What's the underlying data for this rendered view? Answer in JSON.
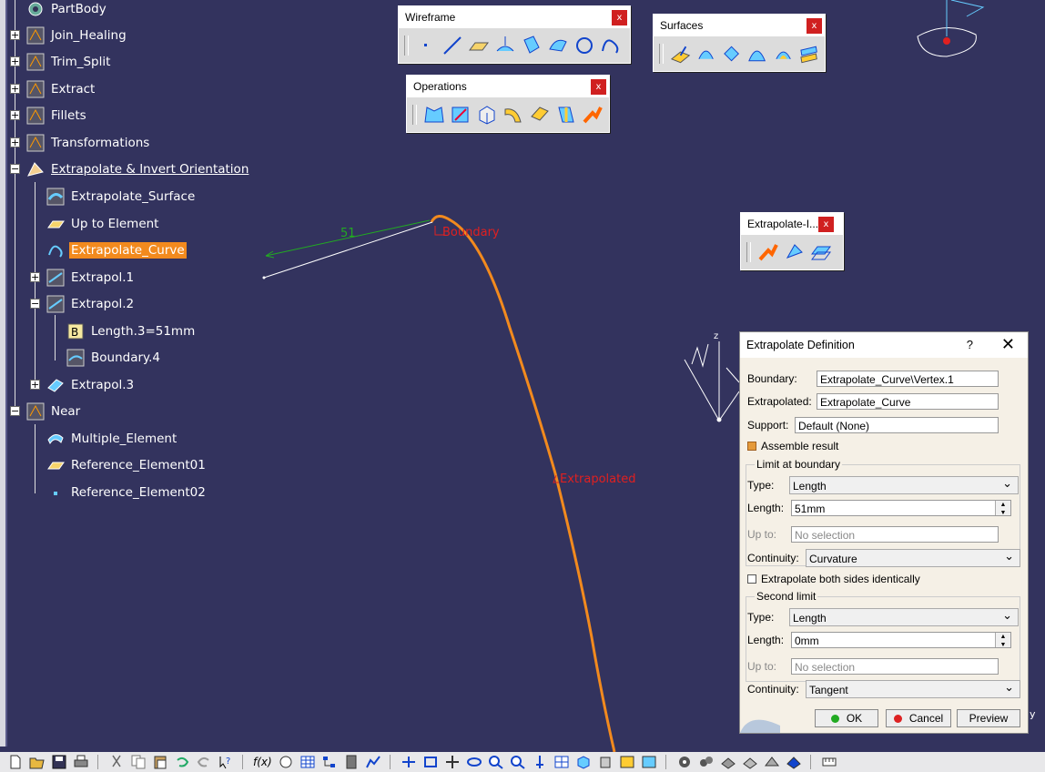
{
  "tree": {
    "items": [
      {
        "label": "PartBody"
      },
      {
        "label": "Join_Healing"
      },
      {
        "label": "Trim_Split"
      },
      {
        "label": "Extract"
      },
      {
        "label": "Fillets"
      },
      {
        "label": "Transformations"
      },
      {
        "label": "Extrapolate & Invert Orientation"
      },
      {
        "label": "Extrapolate_Surface"
      },
      {
        "label": "Up to Element"
      },
      {
        "label": "Extrapolate_Curve"
      },
      {
        "label": "Extrapol.1"
      },
      {
        "label": "Extrapol.2"
      },
      {
        "label": "Length.3=51mm"
      },
      {
        "label": "Boundary.4"
      },
      {
        "label": "Extrapol.3"
      },
      {
        "label": "Near"
      },
      {
        "label": "Multiple_Element"
      },
      {
        "label": "Reference_Element01"
      },
      {
        "label": "Reference_Element02"
      }
    ]
  },
  "viewport": {
    "dimension_label": "51",
    "boundary_label": "Boundary",
    "extrapolated_label": "Extrapolated",
    "axis_z": "z",
    "axis_y": "y",
    "curve_color": "#f28a1e",
    "label_color": "#e02020",
    "dimension_color": "#22aa22"
  },
  "toolbars": {
    "wireframe": {
      "title": "Wireframe",
      "close": "x"
    },
    "surfaces": {
      "title": "Surfaces",
      "close": "x"
    },
    "operations": {
      "title": "Operations",
      "close": "x"
    },
    "extrapolate": {
      "title": "Extrapolate-I...",
      "close": "x"
    }
  },
  "dialog": {
    "title": "Extrapolate Definition",
    "help": "?",
    "close": "✕",
    "boundary_label": "Boundary:",
    "boundary_value": "Extrapolate_Curve\\Vertex.1",
    "extrapolated_label": "Extrapolated:",
    "extrapolated_value": "Extrapolate_Curve",
    "support_label": "Support:",
    "support_value": "Default (None)",
    "assemble_label": "Assemble result",
    "limit_group": "Limit at boundary",
    "type_label": "Type:",
    "type_value": "Length",
    "length_label": "Length:",
    "length_value": "51mm",
    "upto_label": "Up to:",
    "upto_value": "No selection",
    "continuity_label": "Continuity:",
    "continuity_value": "Curvature",
    "both_sides_label": "Extrapolate both sides identically",
    "second_group": "Second limit",
    "type2_label": "Type:",
    "type2_value": "Length",
    "length2_label": "Length:",
    "length2_value": "0mm",
    "upto2_label": "Up to:",
    "upto2_value": "No selection",
    "continuity2_label": "Continuity:",
    "continuity2_value": "Tangent",
    "ok": "OK",
    "cancel": "Cancel",
    "preview": "Preview"
  },
  "bottom_toolbar": {
    "formula_label": "f(x)"
  }
}
